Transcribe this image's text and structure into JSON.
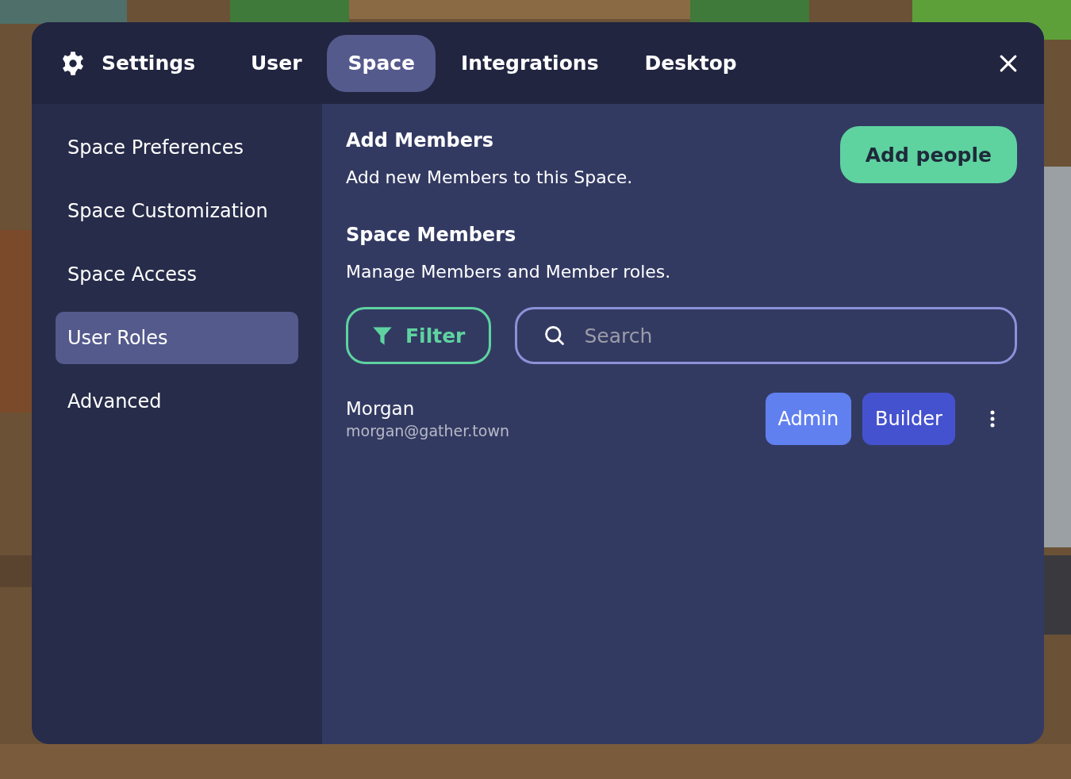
{
  "header": {
    "title": "Settings",
    "tabs": [
      {
        "label": "User",
        "selected": false
      },
      {
        "label": "Space",
        "selected": true
      },
      {
        "label": "Integrations",
        "selected": false
      },
      {
        "label": "Desktop",
        "selected": false
      }
    ]
  },
  "sidebar": {
    "items": [
      {
        "label": "Space Preferences",
        "selected": false
      },
      {
        "label": "Space Customization",
        "selected": false
      },
      {
        "label": "Space Access",
        "selected": false
      },
      {
        "label": "User Roles",
        "selected": true
      },
      {
        "label": "Advanced",
        "selected": false
      }
    ]
  },
  "add_members": {
    "title": "Add Members",
    "description": "Add new Members to this Space.",
    "button": "Add people"
  },
  "space_members": {
    "title": "Space Members",
    "description": "Manage Members and Member roles.",
    "filter_button": "Filter",
    "search": {
      "placeholder": "Search"
    },
    "members": [
      {
        "name": "Morgan",
        "email": "morgan@gather.town",
        "roles": [
          {
            "label": "Admin",
            "color": "#6180f0"
          },
          {
            "label": "Builder",
            "color": "#4552cf"
          }
        ]
      }
    ]
  }
}
